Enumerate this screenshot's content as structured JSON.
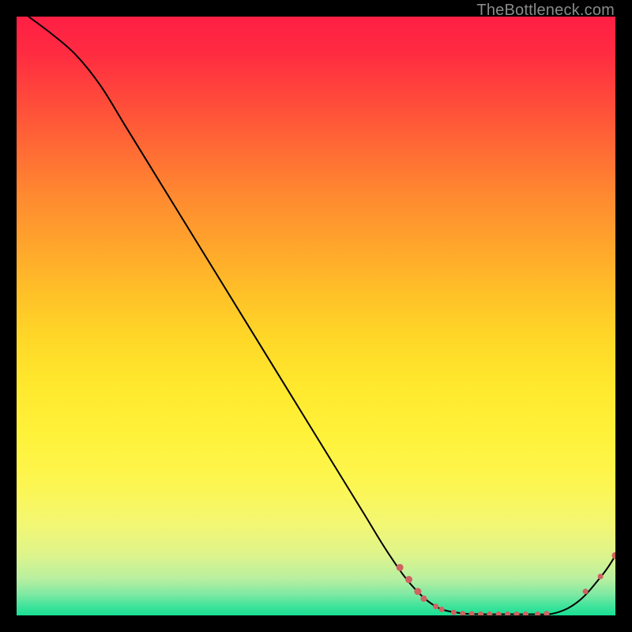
{
  "watermark": "TheBottleneck.com",
  "colors": {
    "marker": "#cf6360",
    "curve": "#000000"
  },
  "chart_data": {
    "type": "line",
    "title": "",
    "xlabel": "",
    "ylabel": "",
    "xlim": [
      0,
      100
    ],
    "ylim": [
      0,
      100
    ],
    "grid": false,
    "legend": false,
    "background": "rainbow-vertical-gradient red→yellow→green",
    "series": [
      {
        "name": "curve",
        "x": [
          2,
          6,
          10,
          14,
          18,
          22,
          26,
          30,
          34,
          38,
          42,
          46,
          50,
          54,
          58,
          62,
          66,
          70,
          74,
          78,
          82,
          86,
          90,
          94,
          98,
          100
        ],
        "y": [
          100,
          97,
          93.5,
          88.5,
          82,
          75.5,
          69,
          62.5,
          56,
          49.5,
          43,
          36.5,
          30,
          23.5,
          17,
          10.5,
          5,
          1.5,
          0.4,
          0.2,
          0.2,
          0.2,
          0.4,
          2.5,
          7,
          10
        ]
      }
    ],
    "markers": [
      {
        "x": 64.0,
        "y": 8.0,
        "r": 4.5
      },
      {
        "x": 65.5,
        "y": 6.0,
        "r": 4.5
      },
      {
        "x": 67.0,
        "y": 4.0,
        "r": 4.5
      },
      {
        "x": 68.0,
        "y": 2.8,
        "r": 4.0
      },
      {
        "x": 70.0,
        "y": 1.5,
        "r": 3.5
      },
      {
        "x": 71.0,
        "y": 1.0,
        "r": 3.5
      },
      {
        "x": 73.0,
        "y": 0.5,
        "r": 3.5
      },
      {
        "x": 74.5,
        "y": 0.3,
        "r": 3.5
      },
      {
        "x": 76.0,
        "y": 0.25,
        "r": 3.5
      },
      {
        "x": 77.5,
        "y": 0.2,
        "r": 3.5
      },
      {
        "x": 79.0,
        "y": 0.2,
        "r": 3.5
      },
      {
        "x": 80.5,
        "y": 0.2,
        "r": 3.5
      },
      {
        "x": 82.0,
        "y": 0.2,
        "r": 3.5
      },
      {
        "x": 83.5,
        "y": 0.2,
        "r": 3.5
      },
      {
        "x": 85.0,
        "y": 0.2,
        "r": 3.5
      },
      {
        "x": 87.0,
        "y": 0.2,
        "r": 3.5
      },
      {
        "x": 88.5,
        "y": 0.3,
        "r": 3.5
      },
      {
        "x": 95.0,
        "y": 4.0,
        "r": 3.5
      },
      {
        "x": 97.5,
        "y": 6.5,
        "r": 3.5
      },
      {
        "x": 100.0,
        "y": 10.0,
        "r": 4.5
      }
    ]
  }
}
